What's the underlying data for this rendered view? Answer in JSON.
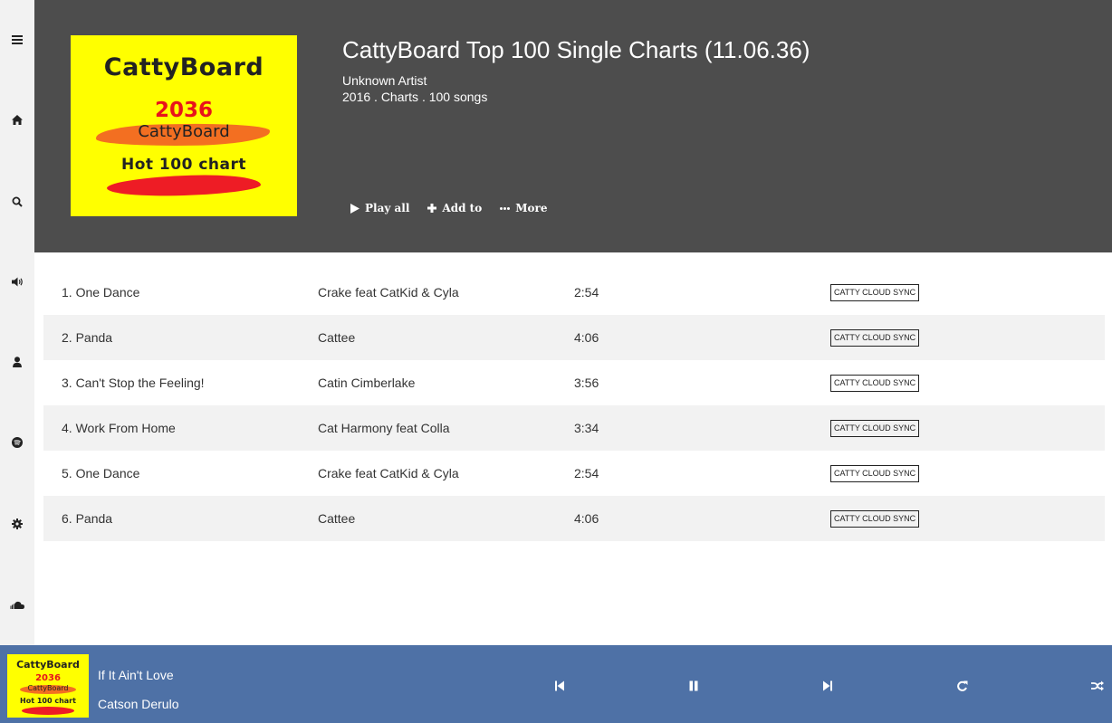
{
  "sidebar": {
    "icons": [
      "menu-icon",
      "home-icon",
      "search-icon",
      "volume-icon",
      "user-icon",
      "spotify-icon",
      "gear-icon",
      "soundcloud-icon"
    ]
  },
  "album": {
    "cover": {
      "line1": "CattyBoard",
      "line2": "2036",
      "line3": "CattyBoard",
      "line4": "Hot 100 chart"
    },
    "title": "CattyBoard Top 100 Single Charts (11.06.36)",
    "artist": "Unknown Artist",
    "details": "2016 . Charts . 100 songs"
  },
  "actions": {
    "play_all": "Play all",
    "add_to": "Add to",
    "more": "More"
  },
  "songs": [
    {
      "title": "1. One Dance",
      "artist": "Crake feat CatKid & Cyla",
      "duration": "2:54",
      "badge": "CATTY CLOUD SYNC"
    },
    {
      "title": "2. Panda",
      "artist": "Cattee",
      "duration": "4:06",
      "badge": "CATTY CLOUD SYNC"
    },
    {
      "title": "3. Can't Stop the Feeling!",
      "artist": "Catin Cimberlake",
      "duration": "3:56",
      "badge": "CATTY CLOUD SYNC"
    },
    {
      "title": "4. Work From Home",
      "artist": "Cat Harmony feat Colla",
      "duration": "3:34",
      "badge": "CATTY CLOUD SYNC"
    },
    {
      "title": "5. One Dance",
      "artist": "Crake feat CatKid & Cyla",
      "duration": "2:54",
      "badge": "CATTY CLOUD SYNC"
    },
    {
      "title": "6. Panda",
      "artist": "Cattee",
      "duration": "4:06",
      "badge": "CATTY CLOUD SYNC"
    }
  ],
  "player": {
    "cover": {
      "line1": "CattyBoard",
      "line2": "2036",
      "line3": "CattyBoard",
      "line4": "Hot 100 chart"
    },
    "track_title": "If It Ain't Love",
    "track_artist": "Catson Derulo",
    "controls": [
      "previous-icon",
      "pause-icon",
      "next-icon",
      "repeat-icon",
      "shuffle-icon"
    ]
  },
  "colors": {
    "header_bg": "#4d4d4d",
    "sidebar_bg": "#f2f2f2",
    "player_bg": "#4e71a6",
    "row_alt_bg": "#f2f2f2",
    "cover_yellow": "#ffff00",
    "cover_red": "#ee1c25",
    "cover_orange": "#f36f21"
  }
}
